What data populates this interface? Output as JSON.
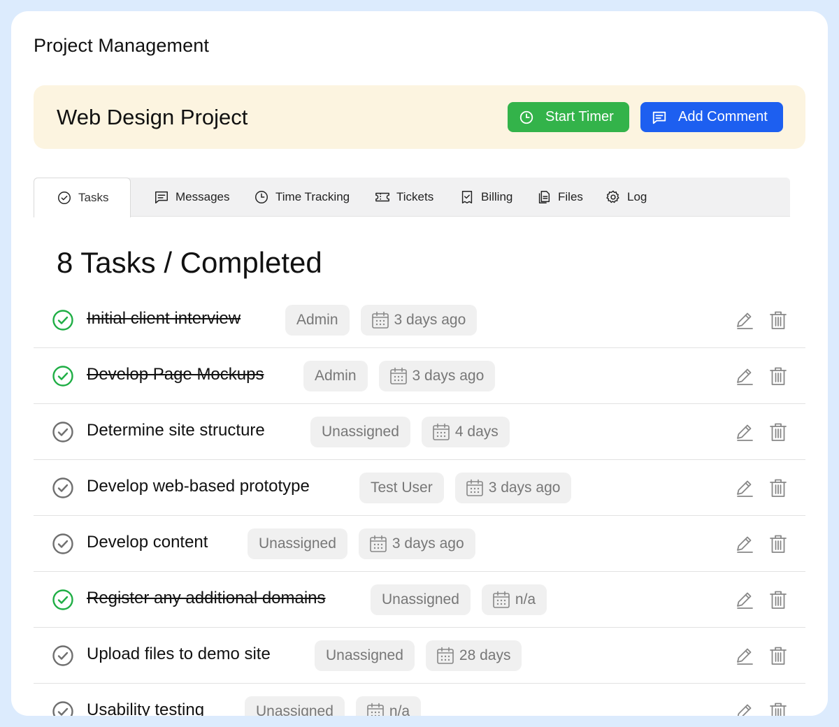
{
  "app": {
    "title": "Project Management"
  },
  "project": {
    "name": "Web Design Project",
    "start_timer_label": "Start Timer",
    "add_comment_label": "Add Comment"
  },
  "tabs": [
    {
      "label": "Tasks",
      "icon": "check-circle-icon",
      "active": true
    },
    {
      "label": "Messages",
      "icon": "message-icon"
    },
    {
      "label": "Time Tracking",
      "icon": "clock-icon"
    },
    {
      "label": "Tickets",
      "icon": "ticket-icon"
    },
    {
      "label": "Billing",
      "icon": "receipt-icon"
    },
    {
      "label": "Files",
      "icon": "file-icon"
    },
    {
      "label": "Log",
      "icon": "gear-icon"
    }
  ],
  "section": {
    "count": "8 Tasks",
    "separator": "/",
    "status": "Completed"
  },
  "colors": {
    "green": "#33b34a",
    "blue": "#1d5ff0",
    "banner": "#fcf4e0",
    "complete_check": "#1fae45",
    "incomplete_check": "#6f6f6f"
  },
  "tasks": [
    {
      "name": "Initial client interview",
      "completed": true,
      "assignee": "Admin",
      "date": "3 days ago"
    },
    {
      "name": "Develop Page Mockups",
      "completed": true,
      "assignee": "Admin",
      "date": "3 days ago"
    },
    {
      "name": "Determine site structure",
      "completed": false,
      "assignee": "Unassigned",
      "date": "4 days"
    },
    {
      "name": "Develop web-based prototype",
      "completed": false,
      "assignee": "Test User",
      "date": "3 days ago"
    },
    {
      "name": "Develop content",
      "completed": false,
      "assignee": "Unassigned",
      "date": "3 days ago"
    },
    {
      "name": "Register any additional domains",
      "completed": true,
      "assignee": "Unassigned",
      "date": "n/a"
    },
    {
      "name": "Upload files to demo site",
      "completed": false,
      "assignee": "Unassigned",
      "date": "28 days"
    },
    {
      "name": "Usability testing",
      "completed": false,
      "assignee": "Unassigned",
      "date": "n/a"
    }
  ]
}
